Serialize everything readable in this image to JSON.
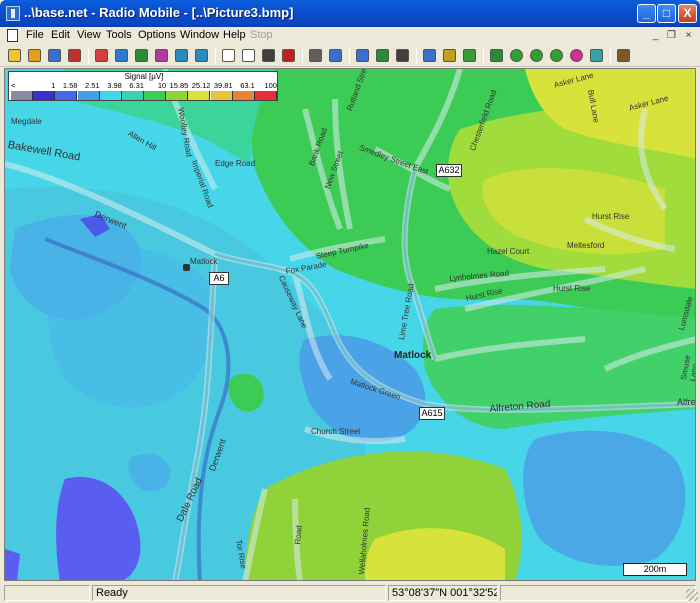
{
  "window": {
    "title": "..\\base.net - Radio Mobile - [..\\Picture3.bmp]",
    "minimize_glyph": "_",
    "maximize_glyph": "□",
    "close_glyph": "X"
  },
  "menu": {
    "items": [
      "File",
      "Edit",
      "View",
      "Tools",
      "Options",
      "Window",
      "Help",
      "Stop"
    ],
    "disabled": [
      "Stop"
    ],
    "mdi_minimize": "_",
    "mdi_restore": "❐",
    "mdi_close": "×"
  },
  "toolbar": {
    "icons": [
      "new-map-icon",
      "open-icon",
      "save-icon",
      "properties-icon",
      "unit-icon",
      "world-icon",
      "earth-icon",
      "merge-icon",
      "back-icon",
      "forward-icon",
      "doc-icon",
      "copy-image-icon",
      "save-image-icon",
      "pdf-icon",
      "print-icon",
      "copy-icon",
      "paste-icon",
      "elevation-icon",
      "center-icon",
      "picture-icon",
      "landmark-icon",
      "selection-icon",
      "radio-link-icon",
      "polar-plot-icon",
      "cartesian-plot-icon",
      "coverage-icon",
      "color-icon",
      "network-icon",
      "exit-icon"
    ]
  },
  "legend": {
    "title": "Signal [µV]",
    "values": [
      "<",
      "1",
      "1.58",
      "2.51",
      "3.98",
      "6.31",
      "10",
      "15.85",
      "25.12",
      "39.81",
      "63.1",
      "100"
    ],
    "colors": [
      "#8a8aa8",
      "#3a2fd0",
      "#4666e8",
      "#3f9fe8",
      "#3fd8e8",
      "#3ad0b0",
      "#3ccc55",
      "#8fd23a",
      "#d7e23a",
      "#e8c43a",
      "#e8843a",
      "#e8303a"
    ]
  },
  "map": {
    "places": {
      "matlock_bold": "Matlock",
      "matlock_station": "Matlock",
      "bakewell_road": "Bakewell Road",
      "derwent1": "Derwent",
      "derwent2": "Derwent",
      "dale_road": "Dale Road",
      "edge_road": "Edge Road",
      "imperial_road": "Imperial Road",
      "woolley_road": "Woolley Road",
      "allen_hill": "Allen Hill",
      "megdale": "Megdale",
      "steep_turnpike": "Steep Turnpike",
      "bank_road": "Bank Road",
      "rutland_st": "Rutland Street",
      "smedley_st": "Smedley Street East",
      "new_street": "New Street",
      "causeway_lane": "Causeway Lane",
      "matlock_green": "Matlock Green",
      "alfreton_road": "Alfreton Road",
      "church_street": "Church Street",
      "hurst_rise": "Hurst Rise",
      "hurst_rise2": "Hurst Rise",
      "hazel_court": "Hazel Court",
      "meltesford": "Meltesford",
      "lynholmes_road": "Lynholmes Road",
      "lime_tree_road": "Lime Tree Road",
      "chesterfield_road": "Chesterfield Road",
      "asker_lane": "Asker Lane",
      "asker_lane2": "Asker Lane",
      "bull_lane": "Bull Lane",
      "tor_rise": "Tor Rise",
      "road_label": "Road",
      "holmes_road": "Wellaholmes Road",
      "fox_parade": "Fox Parade",
      "lumsdale": "Lumsdale",
      "smuse_lane": "Smuse Lane",
      "alfr": "Alfre"
    },
    "shields": {
      "a632": "A632",
      "a6": "A6",
      "a615": "A615"
    },
    "scale_label": "200m"
  },
  "status": {
    "ready": "Ready",
    "coords": "53°08'37\"N 001°32'52\"W"
  }
}
